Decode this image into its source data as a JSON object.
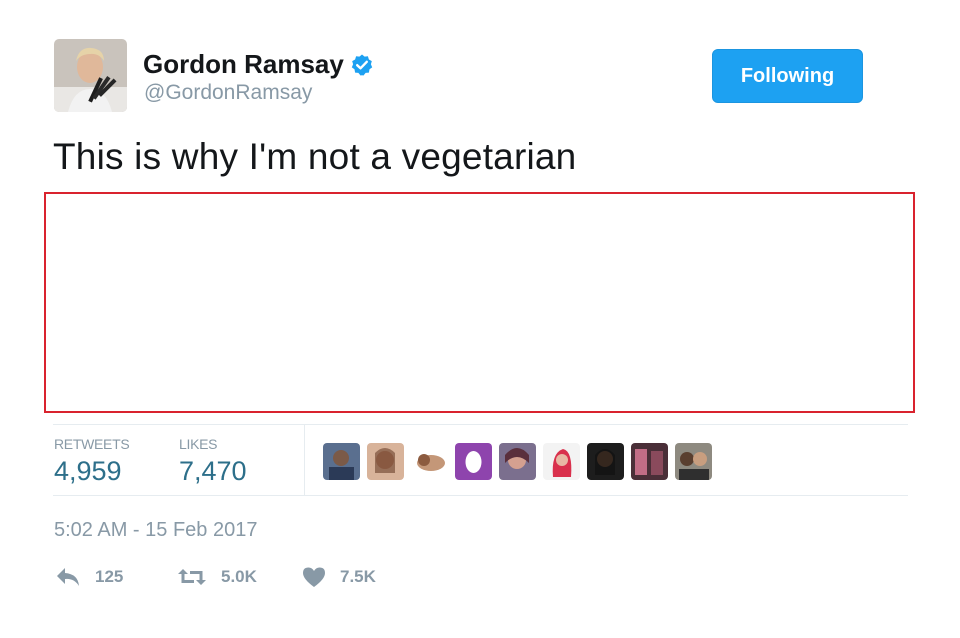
{
  "author": {
    "name": "Gordon Ramsay",
    "handle": "@GordonRamsay",
    "verified": true
  },
  "follow_button": {
    "label": "Following"
  },
  "tweet": {
    "text": "This is why I'm not a vegetarian"
  },
  "stats": {
    "retweets_label": "RETWEETS",
    "retweets_value": "4,959",
    "likes_label": "LIKES",
    "likes_value": "7,470"
  },
  "likers_count": 9,
  "timestamp": "5:02 AM - 15 Feb 2017",
  "actions": {
    "reply": {
      "icon": "reply-icon",
      "count": "125"
    },
    "retweet": {
      "icon": "retweet-icon",
      "count": "5.0K"
    },
    "like": {
      "icon": "heart-icon",
      "count": "7.5K"
    }
  },
  "colors": {
    "follow_button": "#1da1f2",
    "stat_value": "#2d6f8a",
    "muted": "#8899a6",
    "media_border": "#d9232e"
  }
}
